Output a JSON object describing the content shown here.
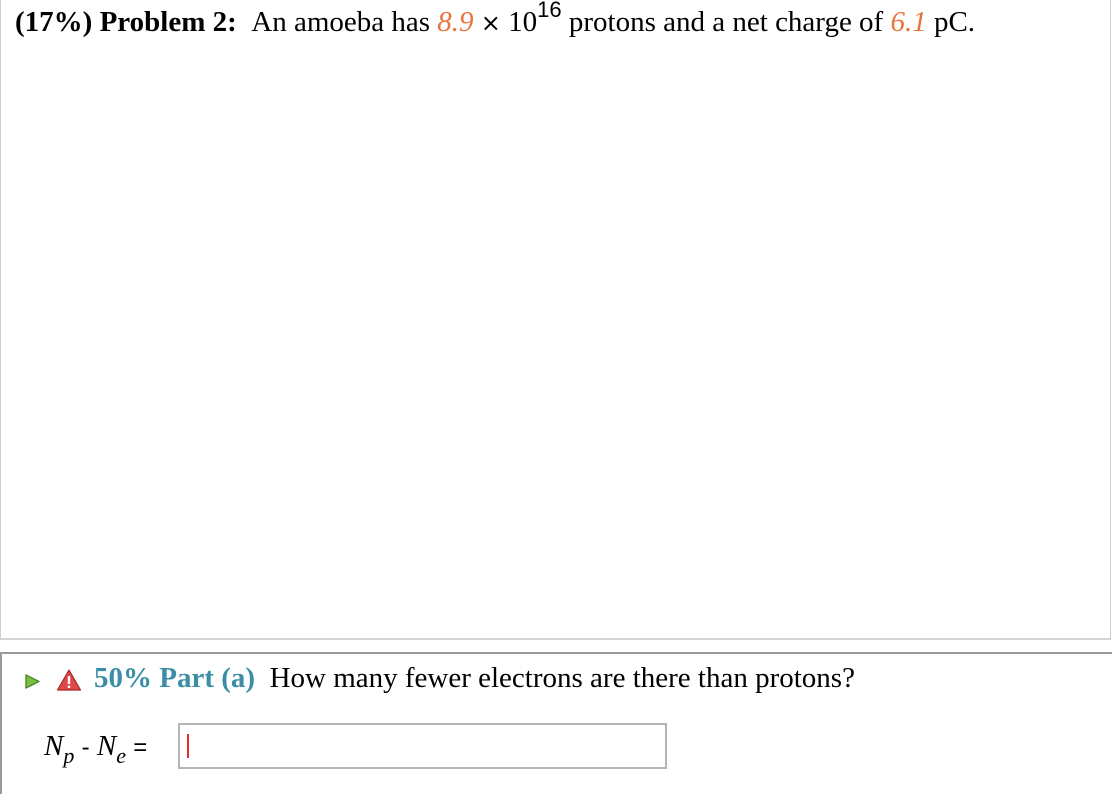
{
  "problem": {
    "percent": "(17%)",
    "label": "Problem 2:",
    "text_before": "An amoeba has",
    "proton_count_mantissa": "8.9",
    "times": "×",
    "base": "10",
    "exponent": "16",
    "text_middle": "protons and a net charge of",
    "net_charge_value": "6.1",
    "charge_unit": "pC."
  },
  "part": {
    "percent": "50%",
    "label": "Part (a)",
    "question": "How many fewer electrons are there than protons?"
  },
  "equation": {
    "np_symbol": "N",
    "np_sub": "p",
    "minus": "-",
    "ne_symbol": "N",
    "ne_sub": "e",
    "equals": "="
  },
  "answer": {
    "value": "",
    "placeholder": ""
  },
  "colors": {
    "given_value": "#e8743b",
    "part_accent": "#3b8ea5",
    "play_icon": "#7bc043",
    "warning_icon": "#e04848"
  },
  "icons": {
    "play": "play-triangle-icon",
    "warning": "warning-triangle-icon"
  }
}
